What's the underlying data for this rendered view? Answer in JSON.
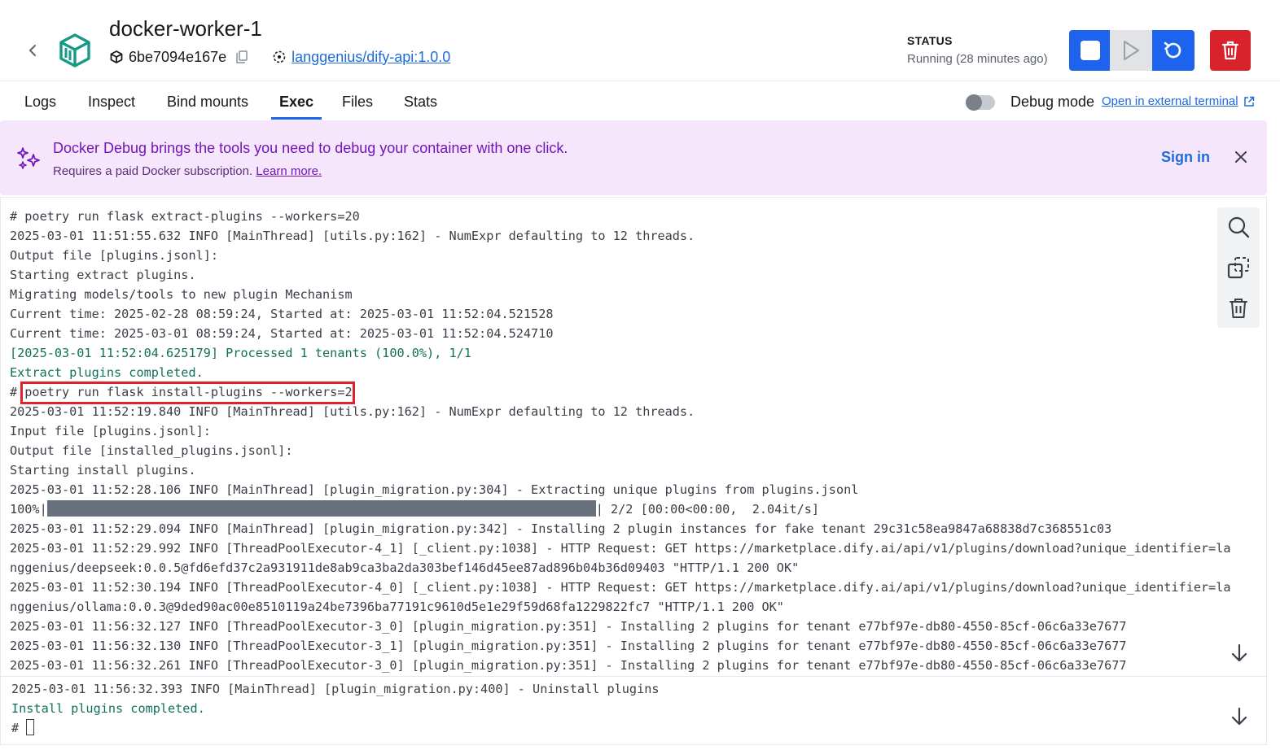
{
  "header": {
    "title": "docker-worker-1",
    "container_id": "6be7094e167e",
    "image_link": "langgenius/dify-api:1.0.0",
    "status_label": "STATUS",
    "status_value": "Running (28 minutes ago)"
  },
  "tabs": [
    {
      "label": "Logs"
    },
    {
      "label": "Inspect"
    },
    {
      "label": "Bind mounts"
    },
    {
      "label": "Exec",
      "active": true
    },
    {
      "label": "Files"
    },
    {
      "label": "Stats"
    }
  ],
  "debug": {
    "label": "Debug mode",
    "enabled": false,
    "external_link": "Open in external terminal"
  },
  "banner": {
    "title": "Docker Debug brings the tools you need to debug your container with one click.",
    "subtitle": "Requires a paid Docker subscription.",
    "learn_more": "Learn more.",
    "sign_in": "Sign in"
  },
  "terminal": {
    "lines": [
      {
        "text": "# poetry run flask extract-plugins --workers=20"
      },
      {
        "text": "2025-03-01 11:51:55.632 INFO [MainThread] [utils.py:162] - NumExpr defaulting to 12 threads."
      },
      {
        "text": "Output file [plugins.jsonl]:"
      },
      {
        "text": "Starting extract plugins."
      },
      {
        "text": "Migrating models/tools to new plugin Mechanism"
      },
      {
        "text": "Current time: 2025-02-28 08:59:24, Started at: 2025-03-01 11:52:04.521528"
      },
      {
        "text": "Current time: 2025-03-01 08:59:24, Started at: 2025-03-01 11:52:04.524710"
      },
      {
        "text": "[2025-03-01 11:52:04.625179] Processed 1 tenants (100.0%), 1/1",
        "green": true
      },
      {
        "text": "Extract plugins completed.",
        "green": true
      },
      {
        "text": "# poetry run flask install-plugins --workers=2"
      },
      {
        "text": "2025-03-01 11:52:19.840 INFO [MainThread] [utils.py:162] - NumExpr defaulting to 12 threads."
      },
      {
        "text": "Input file [plugins.jsonl]:"
      },
      {
        "text": "Output file [installed_plugins.jsonl]:"
      },
      {
        "text": "Starting install plugins."
      },
      {
        "text": "2025-03-01 11:52:28.106 INFO [MainThread] [plugin_migration.py:304] - Extracting unique plugins from plugins.jsonl"
      },
      {
        "progress_prefix": "100%|",
        "progress_suffix": "| 2/2 [00:00<00:00,  2.04it/s]",
        "progress_value": 1.0
      },
      {
        "text": "2025-03-01 11:52:29.094 INFO [MainThread] [plugin_migration.py:342] - Installing 2 plugin instances for fake tenant 29c31c58ea9847a68838d7c368551c03"
      },
      {
        "text": "2025-03-01 11:52:29.992 INFO [ThreadPoolExecutor-4_1] [_client.py:1038] - HTTP Request: GET https://marketplace.dify.ai/api/v1/plugins/download?unique_identifier=la"
      },
      {
        "text": "nggenius/deepseek:0.0.5@fd6efd37c2a931911de8ab9ca3ba2da303bef146d45ee87ad896b04b36d09403 \"HTTP/1.1 200 OK\""
      },
      {
        "text": "2025-03-01 11:52:30.194 INFO [ThreadPoolExecutor-4_0] [_client.py:1038] - HTTP Request: GET https://marketplace.dify.ai/api/v1/plugins/download?unique_identifier=la"
      },
      {
        "text": "nggenius/ollama:0.0.3@9ded90ac00e8510119a24be7396ba77191c9610d5e1e29f59d68fa1229822fc7 \"HTTP/1.1 200 OK\""
      },
      {
        "text": "2025-03-01 11:56:32.127 INFO [ThreadPoolExecutor-3_0] [plugin_migration.py:351] - Installing 2 plugins for tenant e77bf97e-db80-4550-85cf-06c6a33e7677"
      },
      {
        "text": "2025-03-01 11:56:32.130 INFO [ThreadPoolExecutor-3_1] [plugin_migration.py:351] - Installing 2 plugins for tenant e77bf97e-db80-4550-85cf-06c6a33e7677"
      },
      {
        "text": "2025-03-01 11:56:32.261 INFO [ThreadPoolExecutor-3_0] [plugin_migration.py:351] - Installing 2 plugins for tenant e77bf97e-db80-4550-85cf-06c6a33e7677"
      }
    ],
    "lines_bottom": [
      {
        "text": "2025-03-01 11:56:32.393 INFO [MainThread] [plugin_migration.py:400] - Uninstall plugins"
      },
      {
        "text": "Install plugins completed.",
        "green": true
      },
      {
        "text": "# ",
        "cursor": true
      }
    ]
  },
  "colors": {
    "accent": "#1d63ed",
    "danger": "#d8222c",
    "banner_bg": "#f6e6fb",
    "banner_text": "#7216b8",
    "terminal_green": "#12705a",
    "highlight_box": "#e0202a"
  }
}
